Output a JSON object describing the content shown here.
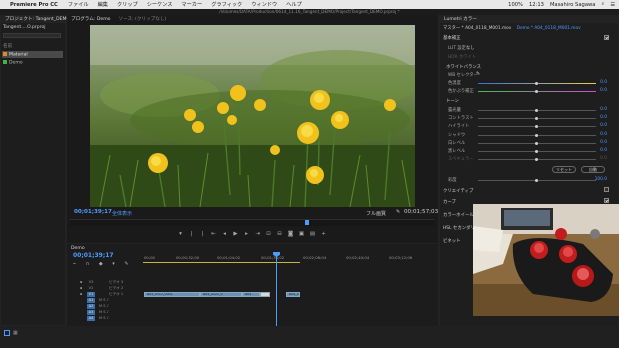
{
  "menubar": {
    "app_name": "Premiere Pro CC",
    "items": [
      "ファイル",
      "編集",
      "クリップ",
      "シーケンス",
      "マーカー",
      "グラフィック",
      "ウィンドウ",
      "ヘルプ"
    ],
    "right": {
      "percent": "100%",
      "clock": "12:13",
      "user": "Masahiro Sagawa"
    }
  },
  "window_title": "/Volumes/DATA/Production/0614_11.16_Tangent_DEMO/Project/Tangent_DEMO.prproj *",
  "project_panel": {
    "tab": "プロジェクト: Tangent_DEMO",
    "file": "Tangent....O.prproj",
    "column_name": "名前",
    "items": [
      {
        "label": "Material",
        "color": "#e08a2a"
      },
      {
        "label": "Demo",
        "color": "#3db34a"
      }
    ]
  },
  "program_monitor": {
    "tabs": [
      "プログラム: Demo",
      "ソース: (クリップなし)"
    ],
    "timecode_current": "00;01;39;17",
    "fit": "全体表示",
    "quality": "フル画質",
    "timecode_duration": "00;01;57;03",
    "transport": [
      "marker",
      "in",
      "out",
      "go-in",
      "step-back",
      "play",
      "step-forward",
      "go-out",
      "insert",
      "overwrite",
      "export-frame",
      "comparison",
      "extract",
      "settings"
    ]
  },
  "timeline": {
    "tab": "Demo",
    "timecode": "00;01;39;17",
    "ruler": [
      "00;00",
      "00;00;32;00",
      "00;01;04;02",
      "00;01;36;02",
      "00;02;08;04",
      "00;02;40;04",
      "00;03;12;06"
    ],
    "tracks": [
      {
        "name": "V3",
        "label": "ビデオ 3"
      },
      {
        "name": "V2",
        "label": "ビデオ 2"
      },
      {
        "name": "V1",
        "label": "ビデオ 1"
      },
      {
        "name": "A1",
        "label": ""
      },
      {
        "name": "A2",
        "label": ""
      },
      {
        "name": "A3",
        "label": ""
      },
      {
        "name": "A4",
        "label": ""
      }
    ],
    "clips": [
      "A04_0312_0001",
      "A04_0222_0",
      "A04",
      "A04_0"
    ]
  },
  "lumetri": {
    "tab": "Lumetri カラー",
    "header": "マスター * A04_0118_M001.mov",
    "header_sub": "Demo * A04_0118_M001.mov",
    "basic": "基本補正",
    "lut_label": "LUT 設定",
    "lut_value": "なし",
    "hdr_label": "HDR ホワイト",
    "wb_section": "ホワイトバランス",
    "wb_selector": "WB セレクター",
    "temp_label": "色温度",
    "tint_label": "色かぶり補正",
    "tone_section": "トーン",
    "tone": [
      {
        "label": "露光量",
        "value": "0.0"
      },
      {
        "label": "コントラスト",
        "value": "0.0"
      },
      {
        "label": "ハイライト",
        "value": "0.0"
      },
      {
        "label": "シャドウ",
        "value": "0.0"
      },
      {
        "label": "白レベル",
        "value": "0.0"
      },
      {
        "label": "黒レベル",
        "value": "0.0"
      },
      {
        "label": "スペキュラー",
        "value": "0.0"
      }
    ],
    "reset": "リセット",
    "auto": "自動",
    "saturation_label": "彩度",
    "saturation_value": "100.0",
    "creative": "クリエイティブ",
    "curves": "カーブ",
    "color_wheels": "カラーホイール",
    "hsl": "HSL セカンダリ",
    "vignette": "ビネット",
    "temp_value": "0.0",
    "tint_value": "0.0"
  },
  "colors": {
    "accent": "#4f9cff",
    "bg": "#232323"
  }
}
